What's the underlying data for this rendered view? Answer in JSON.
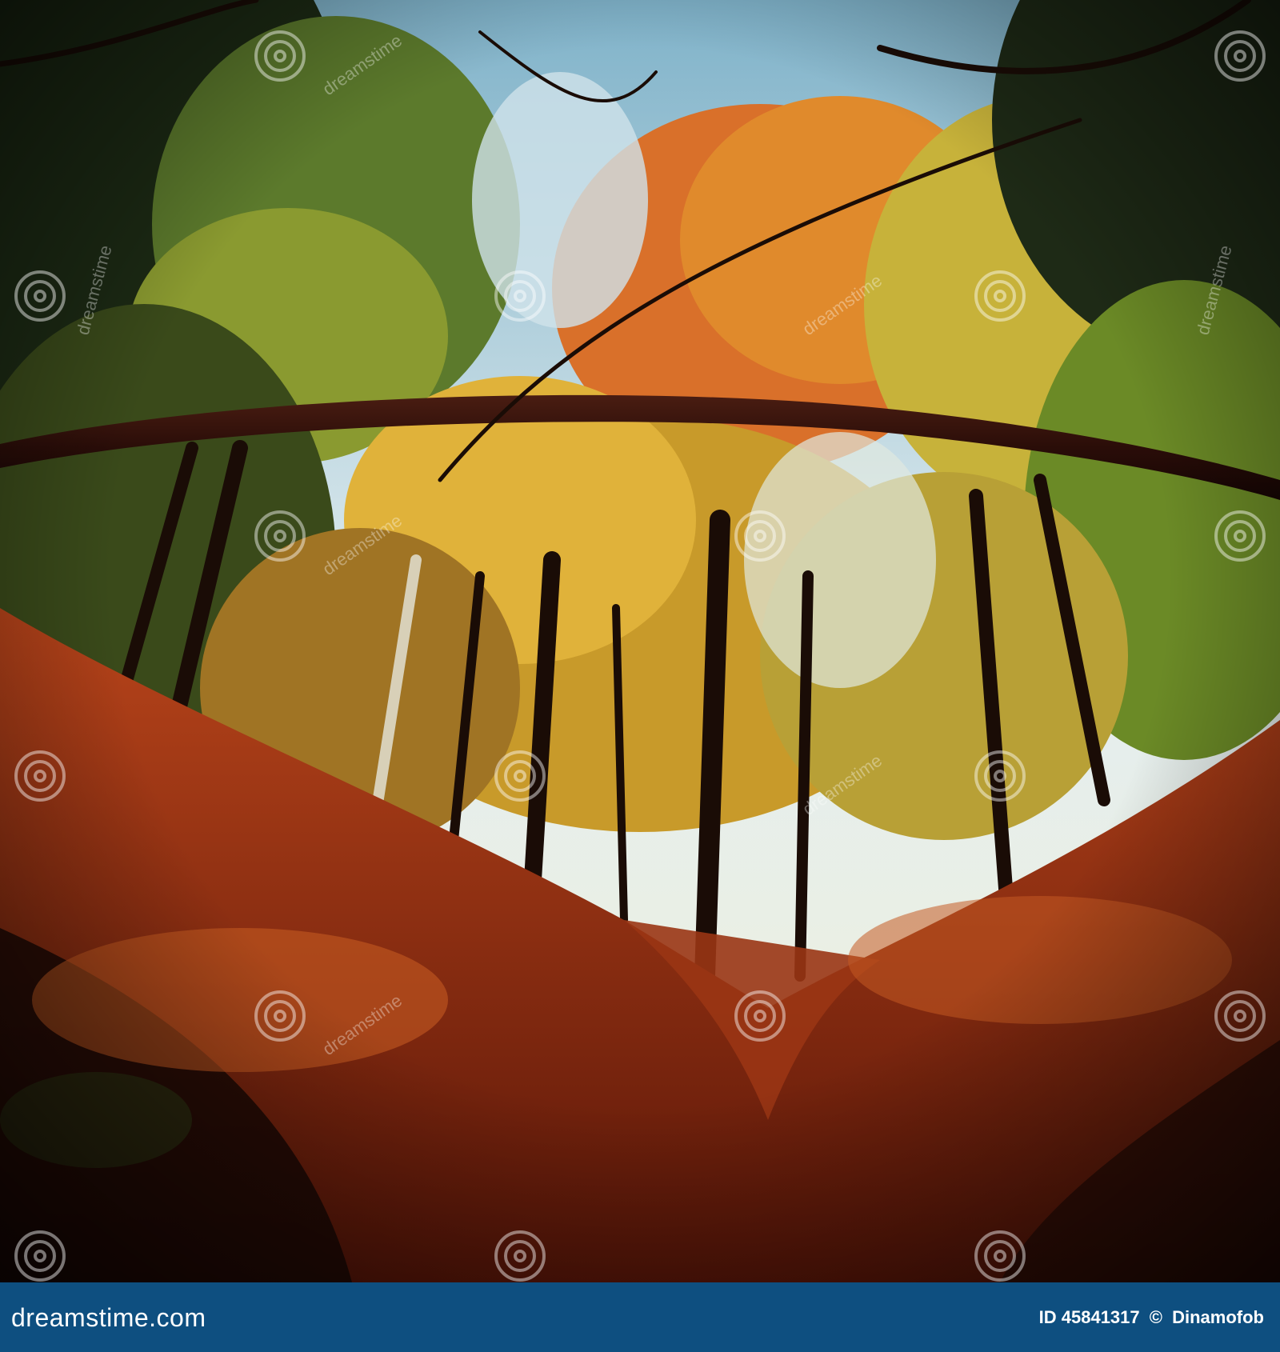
{
  "photo": {
    "subject": "",
    "colors": {
      "sky": "#e4eef0",
      "sky_blue": "#9cc4d6",
      "foliage_orange": "#d9702a",
      "foliage_yellow": "#c7b23a",
      "foliage_green": "#5c7a2c",
      "forest_floor": "#8a2a10",
      "log": "#2a0d08",
      "shadow": "#1a0805"
    }
  },
  "watermark": {
    "icon": "spiral-watermark-icon",
    "text": "dreamstime"
  },
  "footer": {
    "background": "#0e4f80",
    "brand": "dreamstime.com",
    "image_id": "ID 45841317",
    "copyright_symbol": "©",
    "author": "Dinamofob"
  }
}
